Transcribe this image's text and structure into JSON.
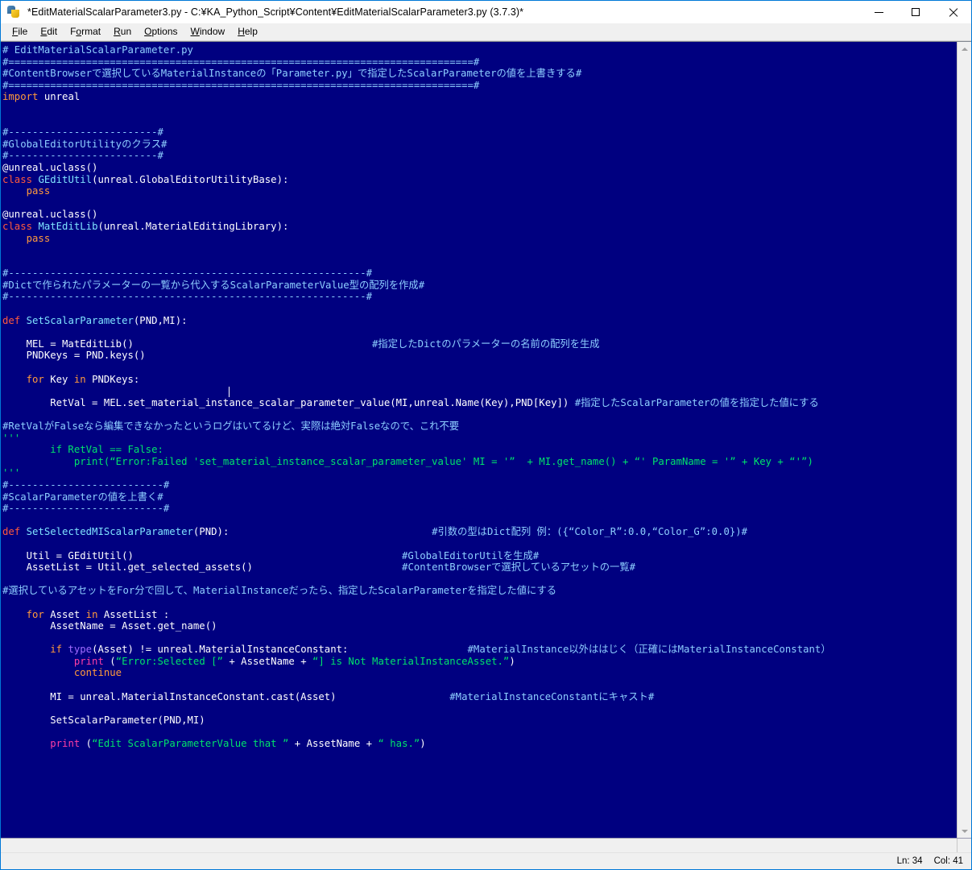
{
  "window": {
    "title": "*EditMaterialScalarParameter3.py - C:¥KA_Python_Script¥Content¥EditMaterialScalarParameter3.py (3.7.3)*",
    "app_icon": "python-idle-icon",
    "controls": {
      "minimize": "minimize-icon",
      "maximize": "maximize-icon",
      "close": "close-icon"
    },
    "accent_color": "#0078d7"
  },
  "menubar": {
    "items": [
      {
        "label": "File",
        "accel": "F"
      },
      {
        "label": "Edit",
        "accel": "E"
      },
      {
        "label": "Format",
        "accel": "o"
      },
      {
        "label": "Run",
        "accel": "R"
      },
      {
        "label": "Options",
        "accel": "O"
      },
      {
        "label": "Window",
        "accel": "W"
      },
      {
        "label": "Help",
        "accel": "H"
      }
    ]
  },
  "editor": {
    "background_color": "#000080",
    "foreground_color": "#ffffff",
    "comment_color": "#8ecfff",
    "keyword_color": "#ff9a3c",
    "definition_color": "#7fe3ff",
    "string_color": "#00e36a",
    "builtin_color": "#a06bff",
    "language": "Python",
    "caret": {
      "line": 34,
      "column": 41
    },
    "lines": [
      {
        "segments": [
          {
            "t": "# EditMaterialScalarParameter.py",
            "k": "c"
          }
        ]
      },
      {
        "segments": [
          {
            "t": "#==============================================================================#",
            "k": "c"
          }
        ]
      },
      {
        "segments": [
          {
            "t": "#ContentBrowserで選択しているMaterialInstanceの「Parameter.py」で指定したScalarParameterの値を上書きする#",
            "k": "c"
          }
        ]
      },
      {
        "segments": [
          {
            "t": "#==============================================================================#",
            "k": "c"
          }
        ]
      },
      {
        "segments": [
          {
            "t": "import",
            "k": "kw"
          },
          {
            "t": " unreal",
            "k": "op"
          }
        ]
      },
      {
        "segments": []
      },
      {
        "segments": []
      },
      {
        "segments": [
          {
            "t": "#-------------------------#",
            "k": "c"
          }
        ]
      },
      {
        "segments": [
          {
            "t": "#GlobalEditorUtilityのクラス#",
            "k": "c"
          }
        ]
      },
      {
        "segments": [
          {
            "t": "#-------------------------#",
            "k": "c"
          }
        ]
      },
      {
        "segments": [
          {
            "t": "@unreal.uclass()",
            "k": "dc"
          }
        ]
      },
      {
        "segments": [
          {
            "t": "class",
            "k": "df"
          },
          {
            "t": " ",
            "k": "op"
          },
          {
            "t": "GEditUtil",
            "k": "fn"
          },
          {
            "t": "(unreal.GlobalEditorUtilityBase):",
            "k": "op"
          }
        ]
      },
      {
        "segments": [
          {
            "t": "    ",
            "k": "op"
          },
          {
            "t": "pass",
            "k": "kw"
          }
        ]
      },
      {
        "segments": []
      },
      {
        "segments": [
          {
            "t": "@unreal.uclass()",
            "k": "dc"
          }
        ]
      },
      {
        "segments": [
          {
            "t": "class",
            "k": "df"
          },
          {
            "t": " ",
            "k": "op"
          },
          {
            "t": "MatEditLib",
            "k": "fn"
          },
          {
            "t": "(unreal.MaterialEditingLibrary):",
            "k": "op"
          }
        ]
      },
      {
        "segments": [
          {
            "t": "    ",
            "k": "op"
          },
          {
            "t": "pass",
            "k": "kw"
          }
        ]
      },
      {
        "segments": []
      },
      {
        "segments": []
      },
      {
        "segments": [
          {
            "t": "#------------------------------------------------------------#",
            "k": "c"
          }
        ]
      },
      {
        "segments": [
          {
            "t": "#Dictで作られたパラメーターの一覧から代入するScalarParameterValue型の配列を作成#",
            "k": "c"
          }
        ]
      },
      {
        "segments": [
          {
            "t": "#------------------------------------------------------------#",
            "k": "c"
          }
        ]
      },
      {
        "segments": []
      },
      {
        "segments": [
          {
            "t": "def",
            "k": "df"
          },
          {
            "t": " ",
            "k": "op"
          },
          {
            "t": "SetScalarParameter",
            "k": "fn"
          },
          {
            "t": "(PND,MI):",
            "k": "op"
          }
        ]
      },
      {
        "segments": []
      },
      {
        "segments": [
          {
            "t": "    MEL = MatEditLib()",
            "k": "op"
          },
          {
            "t": "                                        ",
            "k": "op"
          },
          {
            "t": "#指定したDictのパラメーターの名前の配列を生成",
            "k": "c"
          }
        ]
      },
      {
        "segments": [
          {
            "t": "    PNDKeys = PND.keys()",
            "k": "op"
          }
        ]
      },
      {
        "segments": []
      },
      {
        "segments": [
          {
            "t": "    ",
            "k": "op"
          },
          {
            "t": "for",
            "k": "kw"
          },
          {
            "t": " Key ",
            "k": "op"
          },
          {
            "t": "in",
            "k": "kw"
          },
          {
            "t": " PNDKeys:",
            "k": "op"
          }
        ]
      },
      {
        "segments": []
      },
      {
        "segments": [
          {
            "t": "        RetVal = MEL.set_material_instance_scalar_parameter_value(MI,unreal.Name(Key),PND[Key]) ",
            "k": "op"
          },
          {
            "t": "#指定したScalarParameterの値を指定した値にする",
            "k": "c"
          }
        ]
      },
      {
        "segments": []
      },
      {
        "segments": [
          {
            "t": "#RetValがFalseなら編集できなかったというログはいてるけど、実際は絶対Falseなので、これ不要",
            "k": "c"
          }
        ]
      },
      {
        "segments": [
          {
            "t": "'''",
            "k": "st"
          }
        ]
      },
      {
        "segments": [
          {
            "t": "        if RetVal == False:",
            "k": "st"
          }
        ]
      },
      {
        "segments": [
          {
            "t": "            print(“Error:Failed 'set_material_instance_scalar_parameter_value' MI = '”  + MI.get_name() + “' ParamName = '” + Key + “'”)",
            "k": "st"
          }
        ]
      },
      {
        "segments": [
          {
            "t": "'''",
            "k": "st"
          }
        ]
      },
      {
        "segments": [
          {
            "t": "#--------------------------#",
            "k": "c"
          }
        ]
      },
      {
        "segments": [
          {
            "t": "#ScalarParameterの値を上書く#",
            "k": "c"
          }
        ]
      },
      {
        "segments": [
          {
            "t": "#--------------------------#",
            "k": "c"
          }
        ]
      },
      {
        "segments": []
      },
      {
        "segments": [
          {
            "t": "def",
            "k": "df"
          },
          {
            "t": " ",
            "k": "op"
          },
          {
            "t": "SetSelectedMIScalarParameter",
            "k": "fn"
          },
          {
            "t": "(PND):",
            "k": "op"
          },
          {
            "t": "                                  ",
            "k": "op"
          },
          {
            "t": "#引数の型はDict配列 例：({“Color_R”:0.0,“Color_G”:0.0})#",
            "k": "c"
          }
        ]
      },
      {
        "segments": []
      },
      {
        "segments": [
          {
            "t": "    Util = GEditUtil()",
            "k": "op"
          },
          {
            "t": "                                             ",
            "k": "op"
          },
          {
            "t": "#GlobalEditorUtilを生成#",
            "k": "c"
          }
        ]
      },
      {
        "segments": [
          {
            "t": "    AssetList = Util.get_selected_assets()",
            "k": "op"
          },
          {
            "t": "                         ",
            "k": "op"
          },
          {
            "t": "#ContentBrowserで選択しているアセットの一覧#",
            "k": "c"
          }
        ]
      },
      {
        "segments": []
      },
      {
        "segments": [
          {
            "t": "#選択しているアセットをFor分で回して、MaterialInstanceだったら、指定したScalarParameterを指定した値にする",
            "k": "c"
          }
        ]
      },
      {
        "segments": []
      },
      {
        "segments": [
          {
            "t": "    ",
            "k": "op"
          },
          {
            "t": "for",
            "k": "kw"
          },
          {
            "t": " Asset ",
            "k": "op"
          },
          {
            "t": "in",
            "k": "kw"
          },
          {
            "t": " AssetList :",
            "k": "op"
          }
        ]
      },
      {
        "segments": [
          {
            "t": "        AssetName = Asset.get_name()",
            "k": "op"
          }
        ]
      },
      {
        "segments": []
      },
      {
        "segments": [
          {
            "t": "        ",
            "k": "op"
          },
          {
            "t": "if",
            "k": "kw"
          },
          {
            "t": " ",
            "k": "op"
          },
          {
            "t": "type",
            "k": "bi"
          },
          {
            "t": "(Asset) != unreal.MaterialInstanceConstant:",
            "k": "op"
          },
          {
            "t": "                    ",
            "k": "op"
          },
          {
            "t": "#MaterialInstance以外ははじく（正確にはMaterialInstanceConstant）",
            "k": "c"
          }
        ]
      },
      {
        "segments": [
          {
            "t": "            ",
            "k": "op"
          },
          {
            "t": "print",
            "k": "pr"
          },
          {
            "t": " (",
            "k": "op"
          },
          {
            "t": "“Error:Selected [”",
            "k": "st"
          },
          {
            "t": " + AssetName + ",
            "k": "op"
          },
          {
            "t": "“] is Not MaterialInstanceAsset.”",
            "k": "st"
          },
          {
            "t": ")",
            "k": "op"
          }
        ]
      },
      {
        "segments": [
          {
            "t": "            ",
            "k": "op"
          },
          {
            "t": "continue",
            "k": "kw"
          }
        ]
      },
      {
        "segments": []
      },
      {
        "segments": [
          {
            "t": "        MI = unreal.MaterialInstanceConstant.cast(Asset)",
            "k": "op"
          },
          {
            "t": "                   ",
            "k": "op"
          },
          {
            "t": "#MaterialInstanceConstantにキャスト#",
            "k": "c"
          }
        ]
      },
      {
        "segments": []
      },
      {
        "segments": [
          {
            "t": "        SetScalarParameter(PND,MI)",
            "k": "op"
          }
        ]
      },
      {
        "segments": []
      },
      {
        "segments": [
          {
            "t": "        ",
            "k": "op"
          },
          {
            "t": "print",
            "k": "pr"
          },
          {
            "t": " (",
            "k": "op"
          },
          {
            "t": "“Edit ScalarParameterValue that ”",
            "k": "st"
          },
          {
            "t": " + AssetName + ",
            "k": "op"
          },
          {
            "t": "“ has.”",
            "k": "st"
          },
          {
            "t": ")",
            "k": "op"
          }
        ]
      }
    ]
  },
  "scrollbars": {
    "vertical": {
      "up_icon": "chevron-up-icon",
      "down_icon": "chevron-down-icon"
    },
    "horizontal": {
      "thumb_left_pct": 0,
      "thumb_width_pct": 100
    }
  },
  "statusbar": {
    "line_label": "Ln: 34",
    "col_label": "Col: 41"
  }
}
